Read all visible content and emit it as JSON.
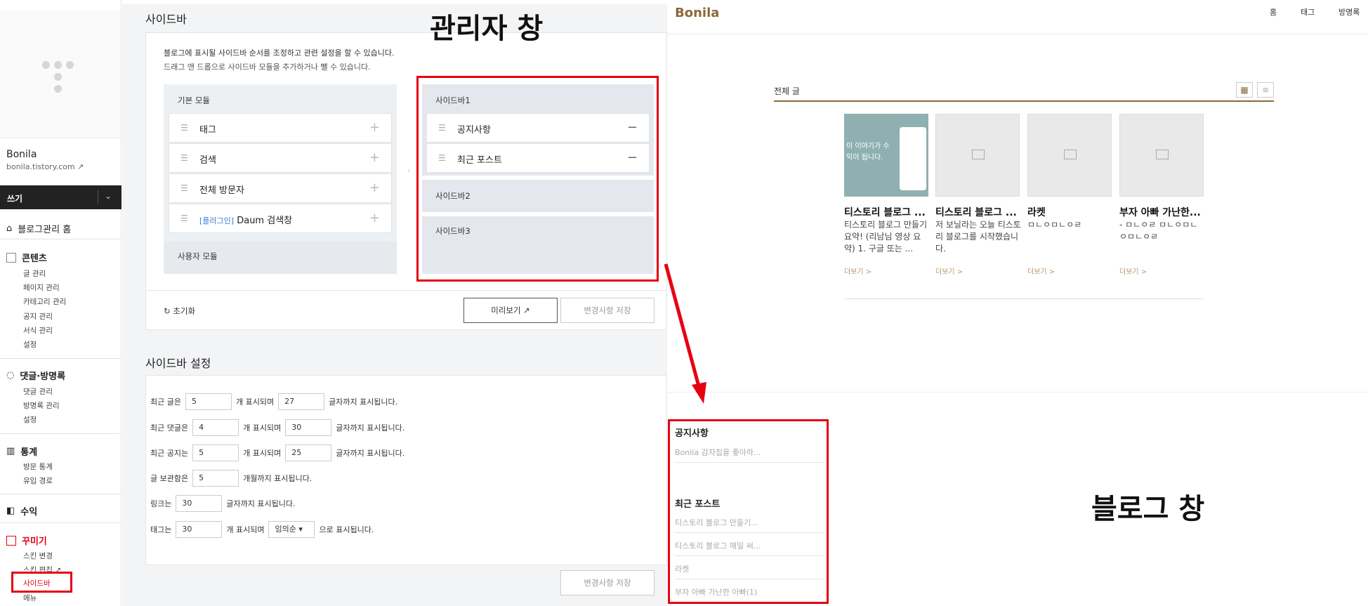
{
  "admin": {
    "blog_name": "Bonila",
    "blog_url": "bonila.tistory.com",
    "write_label": "쓰기",
    "nav_home": "블로그관리 홈",
    "sections": {
      "contents": {
        "title": "콘텐츠",
        "items": [
          "글 관리",
          "페이지 관리",
          "카테고리 관리",
          "공지 관리",
          "서식 관리",
          "설정"
        ]
      },
      "comments": {
        "title": "댓글·방명록",
        "items": [
          "댓글 관리",
          "방명록 관리",
          "설정"
        ]
      },
      "stats": {
        "title": "통계",
        "items": [
          "방문 통계",
          "유입 경로"
        ]
      },
      "revenue": {
        "title": "수익"
      },
      "deco": {
        "title": "꾸미기",
        "items": [
          "스킨 변경",
          "스킨 편집",
          "사이드바",
          "메뉴"
        ]
      }
    },
    "sidebar_section": {
      "title": "사이드바",
      "desc1": "블로그에 표시될 사이드바 순서를 조정하고 관련 설정을 할 수 있습니다.",
      "desc2": "드래그 앤 드롭으로 사이드바 모듈을 추가하거나 뺄 수 있습니다.",
      "basic_module": "기본 모듈",
      "modules": [
        "태그",
        "검색",
        "전체 방문자",
        "Daum 검색창"
      ],
      "plugin_tag": "[플러그인]",
      "user_module": "사용자 모듈",
      "sidebar1": "사이드바1",
      "sidebar1_items": [
        "공지사항",
        "최근 포스트"
      ],
      "sidebar2": "사이드바2",
      "sidebar3": "사이드바3",
      "reset": "초기화",
      "preview": "미리보기",
      "save": "변경사항 저장"
    },
    "settings": {
      "title": "사이드바 설정",
      "recent_posts": {
        "label": "최근 글은",
        "count": "5",
        "mid": "개 표시되며",
        "chars": "27",
        "end": "글자까지 표시됩니다."
      },
      "recent_comments": {
        "label": "최근 댓글은",
        "count": "4",
        "mid": "개 표시되며",
        "chars": "30",
        "end": "글자까지 표시됩니다."
      },
      "recent_notices": {
        "label": "최근 공지는",
        "count": "5",
        "mid": "개 표시되며",
        "chars": "25",
        "end": "글자까지 표시됩니다."
      },
      "archive": {
        "label": "글 보관함은",
        "count": "5",
        "end": "개월까지 표시됩니다."
      },
      "links": {
        "label": "링크는",
        "chars": "30",
        "end": "글자까지 표시됩니다."
      },
      "tags": {
        "label": "태그는",
        "count": "30",
        "mid": "개 표시되며",
        "order": "임의순",
        "end": "으로 표시됩니다."
      },
      "save": "변경사항 저장"
    }
  },
  "annotations": {
    "admin_title": "관리자 창",
    "blog_title": "블로그 창"
  },
  "blog": {
    "name": "Bonila",
    "nav": [
      "홈",
      "태그",
      "방명록"
    ],
    "all_posts": "전체 글",
    "posts": [
      {
        "title": "티스토리 블로그 ...",
        "desc": "티스토리 블로그 만들기 요약! (리남님 영상 요약) 1. 구글 또는 ...",
        "more": "더보기 >",
        "thumb_text": "이 이야기가 수익이 됩니다."
      },
      {
        "title": "티스토리 블로그 ...",
        "desc": "저 보닐라는 오늘 티스토리 블로그를 시작했습니다.",
        "more": "더보기 >"
      },
      {
        "title": "라켓",
        "desc": "ㅁㄴㅇㅁㄴㅇㄹ",
        "more": "더보기 >"
      },
      {
        "title": "부자 아빠 가난한...",
        "desc": "- ㅁㄴㅇㄹ ㅁㄴㅇㅁㄴ ㅇㅁㄴㅇㄹ",
        "more": "더보기 >"
      }
    ],
    "widgets": {
      "notice_title": "공지사항",
      "notice_item": "Bonila 감자칩을 좋아하...",
      "recent_title": "최근 포스트",
      "recent_items": [
        "티스토리 블로그 만들기...",
        "티스토리 블로그 매일 써...",
        "라켓",
        "부자 아빠 가난한 아빠(1)"
      ]
    }
  },
  "colors": {
    "accent_red": "#e60012",
    "brand_brown": "#8a6a3a",
    "dark": "#222222"
  }
}
